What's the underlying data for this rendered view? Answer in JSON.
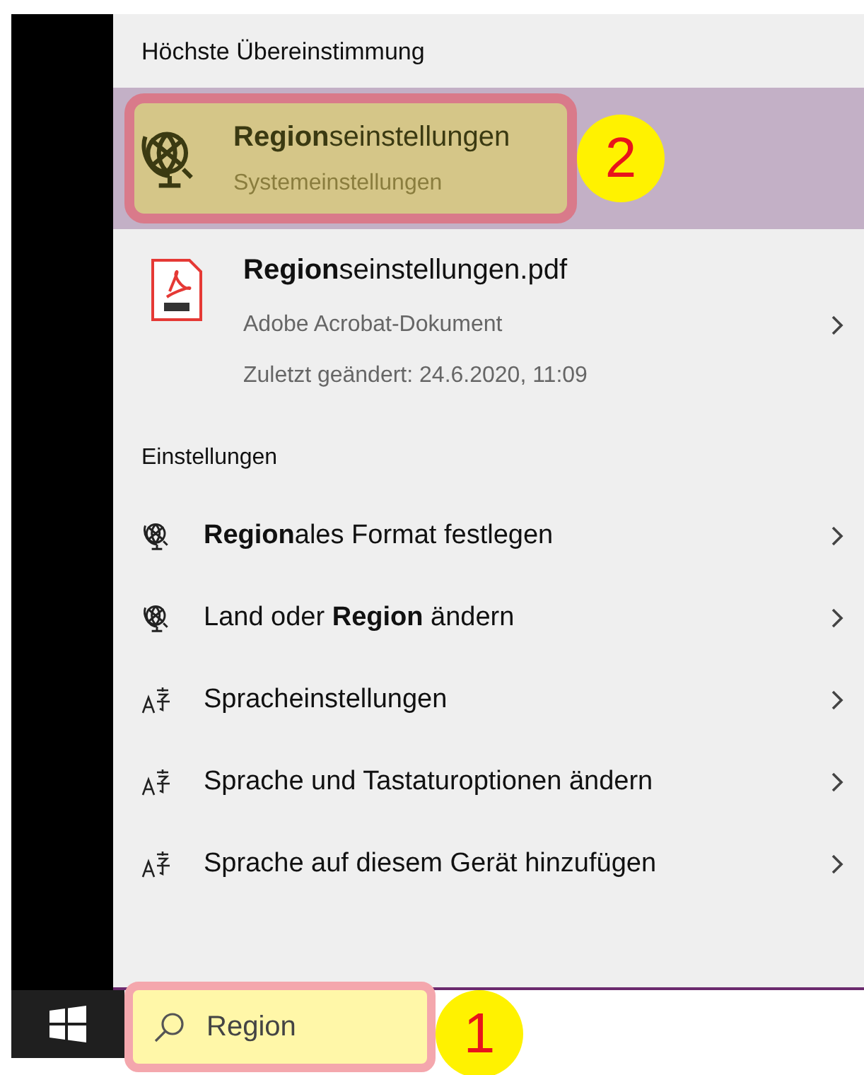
{
  "best_match": {
    "heading": "Höchste Übereinstimmung",
    "top_result": {
      "title": "**Region**seinstellungen",
      "subtitle": "Systemeinstellungen",
      "selected": true,
      "annotation": "2"
    },
    "document": {
      "title": "**Region**seinstellungen.pdf",
      "type": "Adobe Acrobat-Dokument",
      "modified": "Zuletzt geändert: 24.6.2020, 11:09"
    }
  },
  "settings": {
    "heading": "Einstellungen",
    "items": [
      {
        "kind": "globe",
        "label": "**Region**ales Format festlegen"
      },
      {
        "kind": "globe",
        "label": "Land oder **Region** ändern"
      },
      {
        "kind": "language",
        "label": "Spracheinstellungen"
      },
      {
        "kind": "language",
        "label": "Sprache und Tastaturoptionen ändern"
      },
      {
        "kind": "language",
        "label": "Sprache auf diesem Gerät hinzufügen"
      }
    ]
  },
  "search": {
    "value": "Region",
    "annotation": "1"
  }
}
